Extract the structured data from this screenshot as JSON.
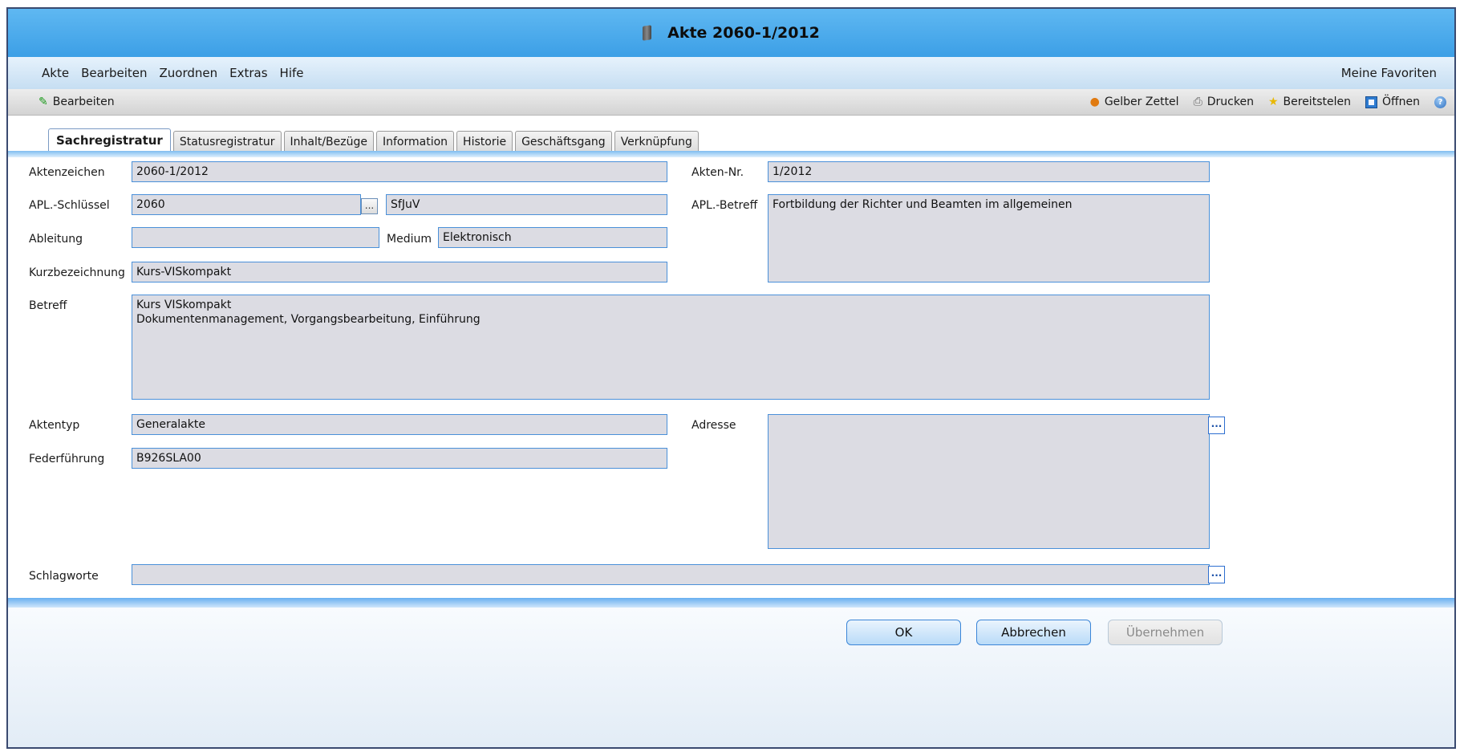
{
  "window": {
    "title": "Akte 2060-1/2012"
  },
  "menubar": {
    "items": [
      "Akte",
      "Bearbeiten",
      "Zuordnen",
      "Extras",
      "Hife"
    ],
    "favorites": "Meine Favoriten"
  },
  "toolbar": {
    "edit": "Bearbeiten",
    "yellow_note": "Gelber Zettel",
    "print": "Drucken",
    "provide": "Bereitstelen",
    "open": "Öffnen"
  },
  "tabs": [
    "Sachregistratur",
    "Statusregistratur",
    "Inhalt/Bezüge",
    "Information",
    "Historie",
    "Geschäftsgang",
    "Verknüpfung"
  ],
  "form": {
    "aktenzeichen": {
      "label": "Aktenzeichen",
      "value": "2060-1/2012"
    },
    "akten_nr": {
      "label": "Akten-Nr.",
      "value": "1/2012"
    },
    "apl_schluessel": {
      "label": "APL.-Schlüssel",
      "value": "2060",
      "short": "SfJuV"
    },
    "apl_betreff": {
      "label": "APL.-Betreff",
      "value": "Fortbildung der Richter und Beamten im allgemeinen"
    },
    "ableitung": {
      "label": "Ableitung",
      "value": ""
    },
    "medium": {
      "label": "Medium",
      "value": "Elektronisch"
    },
    "kurzbezeichnung": {
      "label": "Kurzbezeichnung",
      "value": "Kurs-VISkompakt"
    },
    "betreff": {
      "label": "Betreff",
      "value": "Kurs VISkompakt\nDokumentenmanagement, Vorgangsbearbeitung, Einführung"
    },
    "aktentyp": {
      "label": "Aktentyp",
      "value": "Generalakte"
    },
    "adresse": {
      "label": "Adresse",
      "value": ""
    },
    "federfuehrung": {
      "label": "Federführung",
      "value": "B926SLA00"
    },
    "schlagworte": {
      "label": "Schlagworte",
      "value": ""
    },
    "ellipsis": "..."
  },
  "buttons": {
    "ok": "OK",
    "cancel": "Abbrechen",
    "apply": "Übernehmen"
  },
  "icons": [
    "document-icon",
    "pencil-icon",
    "yellow-note-icon",
    "printer-icon",
    "star-icon",
    "open-icon",
    "help-icon"
  ],
  "colors": {
    "titlebar": "#4aa9ec",
    "field_bg": "#dcdce3",
    "field_border": "#4a90d9"
  }
}
